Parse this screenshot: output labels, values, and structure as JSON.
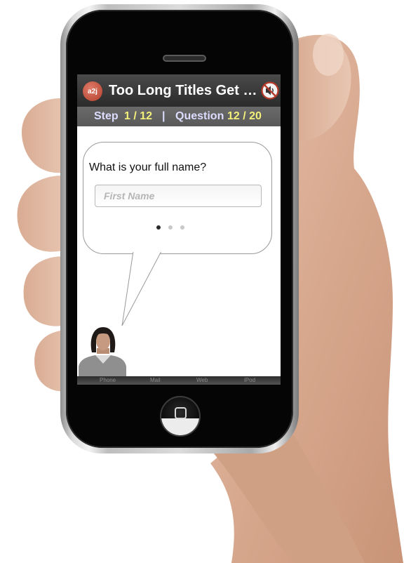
{
  "app": {
    "logo_text": "a2j",
    "title": "Too Long Titles Get Cu...",
    "mute_icon": "speaker-muted-icon",
    "accent_color": "#c0473a"
  },
  "stepbar": {
    "step_label": "Step",
    "step_value": "1 / 12",
    "separator": "|",
    "question_label": "Question",
    "question_value": "12 / 20",
    "value_color": "#f3f07a"
  },
  "question": {
    "text": "What is your full name?",
    "input_placeholder": "First Name",
    "input_value": "",
    "pager": {
      "pages": 3,
      "current": 1
    }
  },
  "dock": {
    "items": [
      "Phone",
      "Mail",
      "Web",
      "iPod"
    ]
  }
}
